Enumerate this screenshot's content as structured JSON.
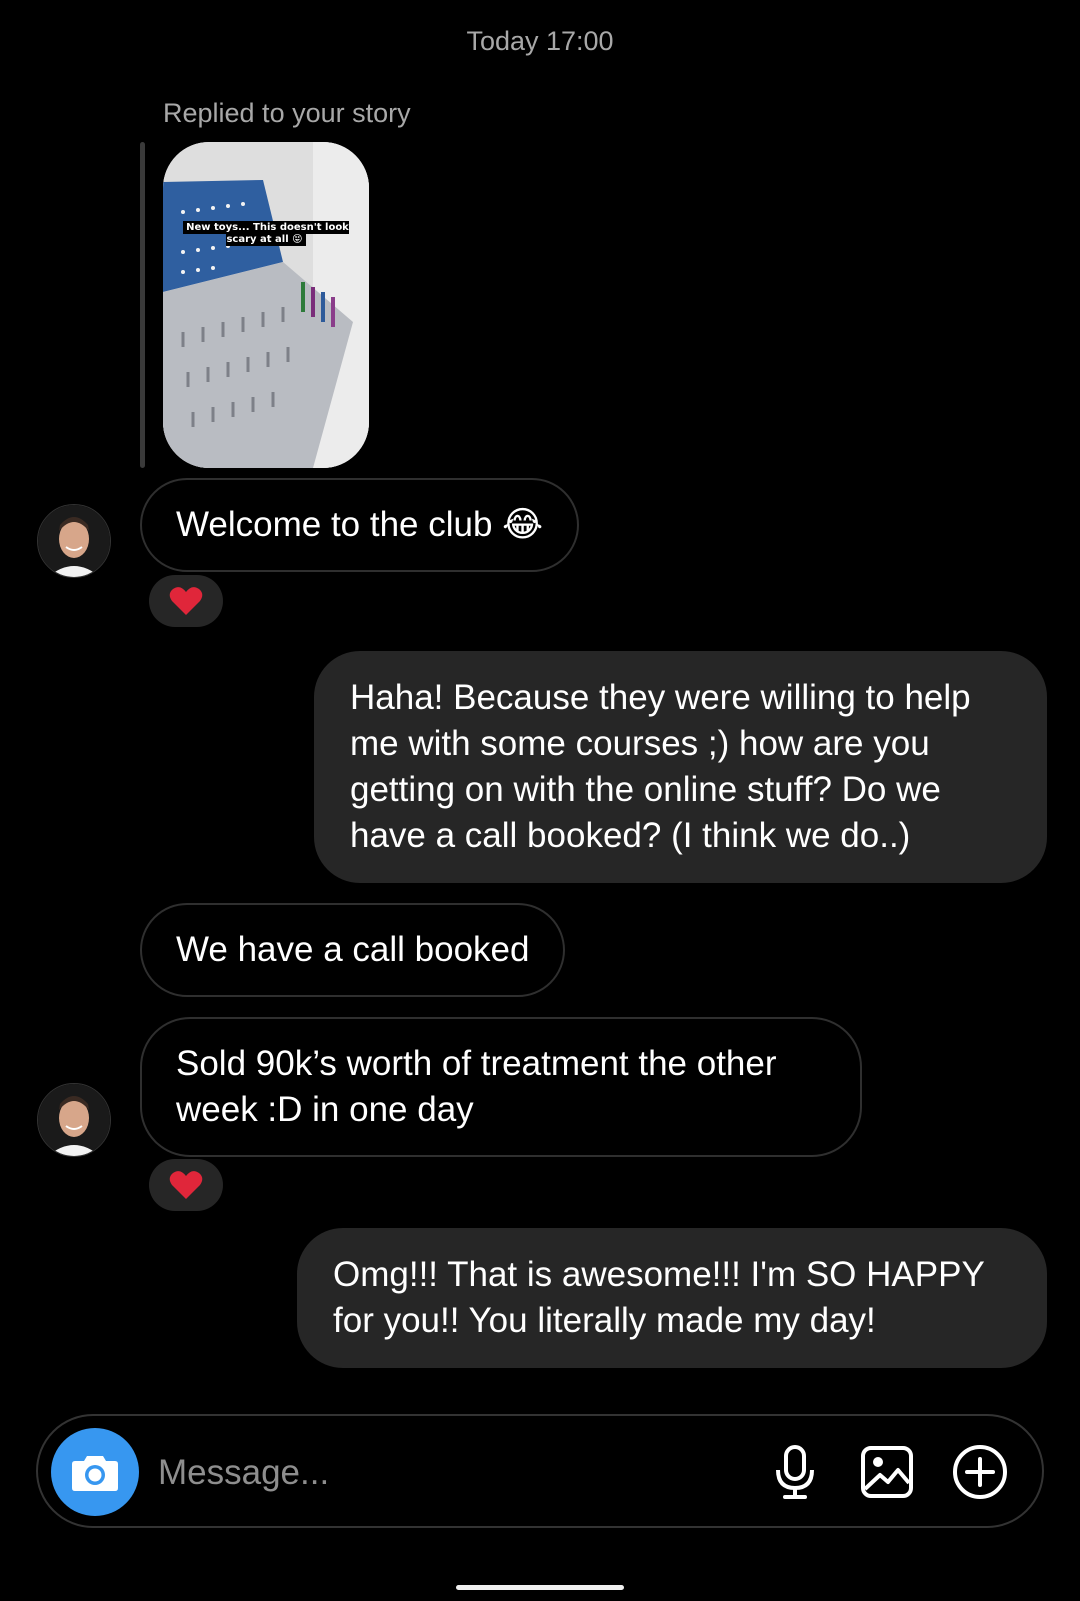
{
  "thread": {
    "timestamp": "Today 17:00",
    "reply_label": "Replied to your story",
    "story_caption": "New toys... This doesn't look scary at all 😝"
  },
  "messages": [
    {
      "direction": "incoming",
      "text": "Welcome to the club 😂",
      "reaction": "❤️"
    },
    {
      "direction": "outgoing",
      "text": "Haha! Because they were willing to help me with some courses ;) how are you getting on with the online stuff? Do we have a call booked? (I think we do..)"
    },
    {
      "direction": "incoming",
      "text": "We have a call booked"
    },
    {
      "direction": "incoming",
      "text": "Sold 90k’s worth of treatment the other week :D in one day",
      "reaction": "❤️"
    },
    {
      "direction": "outgoing",
      "text": "Omg!!! That is awesome!!! I'm SO HAPPY for you!! You literally made my day!"
    }
  ],
  "composer": {
    "placeholder": "Message...",
    "icons": [
      "camera-icon",
      "microphone-icon",
      "gallery-icon",
      "plus-circle-icon"
    ],
    "camera_color": "#3797f0"
  }
}
